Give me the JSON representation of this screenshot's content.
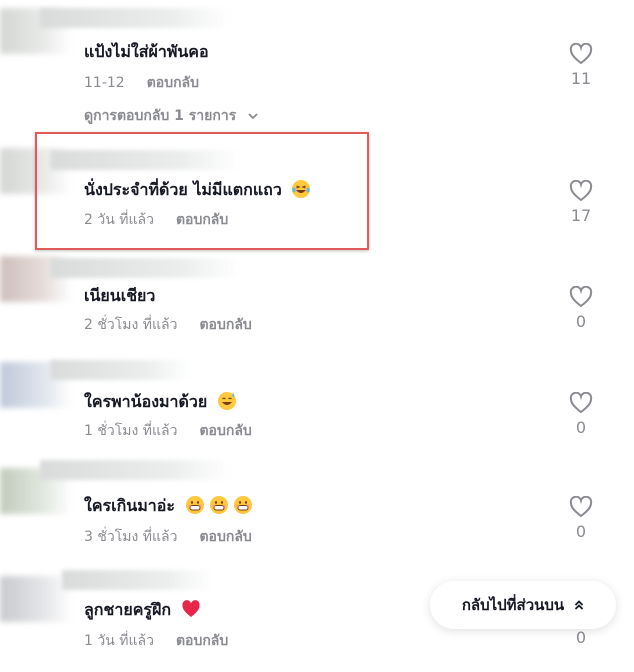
{
  "comments": [
    {
      "text": "แป้งไม่ใส่ผ้าพันคอ",
      "time": "11-12",
      "reply": "ตอบกลับ",
      "likes": "11",
      "emojis": []
    },
    {
      "text": "นั่งประจำที่ด้วย ไม่มีแตกแถว",
      "time": "2 วัน ที่แล้ว",
      "reply": "ตอบกลับ",
      "likes": "17",
      "emojis": [
        "laugh-tears-emoji"
      ]
    },
    {
      "text": "เนียนเชียว",
      "time": "2 ชั่วโมง ที่แล้ว",
      "reply": "ตอบกลับ",
      "likes": "0",
      "emojis": []
    },
    {
      "text": "ใครพาน้องมาด้วย",
      "time": "1 ชั่วโมง ที่แล้ว",
      "reply": "ตอบกลับ",
      "likes": "0",
      "emojis": [
        "sweat-smile-emoji"
      ]
    },
    {
      "text": "ใครเกินมาอ่ะ",
      "time": "3 ชั่วโมง ที่แล้ว",
      "reply": "ตอบกลับ",
      "likes": "0",
      "emojis": [
        "grin-emoji",
        "grin-emoji",
        "grin-emoji"
      ]
    },
    {
      "text": "ลูกชายครูฝึก",
      "time": "1 วัน ที่แล้ว",
      "reply": "ตอบกลับ",
      "likes": "0",
      "emojis": [
        "heart-emoji"
      ]
    }
  ],
  "view_replies": "ดูการตอบกลับ 1 รายการ",
  "back_to_top": "กลับไปที่ส่วนบน",
  "colors": {
    "text": "#161823",
    "muted": "#8a8b91",
    "highlight_border": "#e05a5a",
    "heart_emoji": "#e8264a",
    "emoji_face": "#ffc83d"
  },
  "icons": [
    "heart-outline-icon",
    "chevron-down-icon",
    "chevron-double-up-icon"
  ]
}
